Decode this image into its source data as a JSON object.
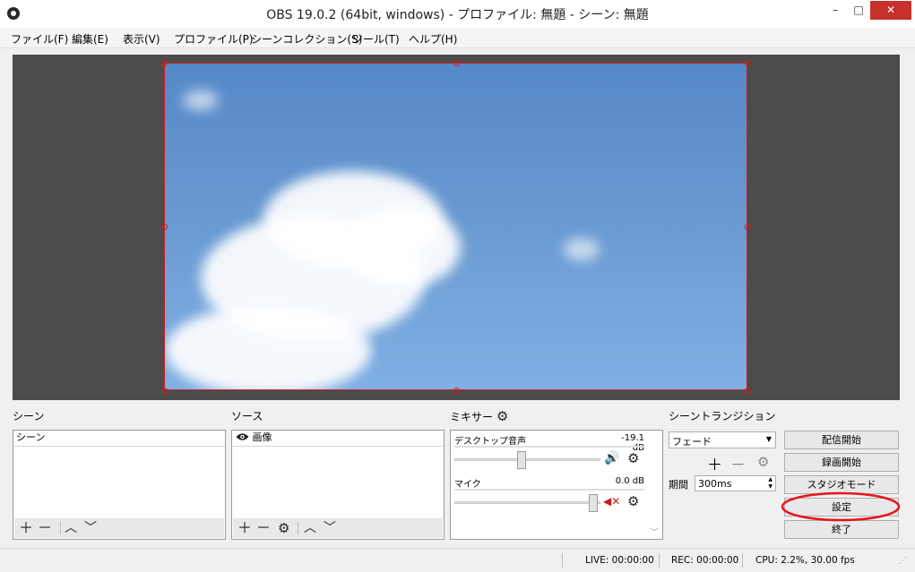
{
  "window": {
    "title": "OBS 19.0.2 (64bit, windows) - プロファイル: 無題 - シーン: 無題",
    "minimize": "–",
    "maximize": "□",
    "close": "✕"
  },
  "menu": [
    "ファイル(F)",
    "編集(E)",
    "表示(V)",
    "プロファイル(P)",
    "シーンコレクション(S)",
    "ツール(T)",
    "ヘルプ(H)"
  ],
  "scenes": {
    "title": "シーン",
    "items": [
      "シーン"
    ]
  },
  "sources": {
    "title": "ソース",
    "items": [
      {
        "name": "画像",
        "visible": true,
        "icon": "eye-icon"
      }
    ]
  },
  "mixer": {
    "title": "ミキサー",
    "channels": [
      {
        "name": "デスクトップ音声",
        "level": "-19.1 dB",
        "muted": false,
        "volume_fraction": 0.46
      },
      {
        "name": "マイク",
        "level": "0.0 dB",
        "muted": true,
        "volume_fraction": 0.98
      }
    ]
  },
  "transitions": {
    "title": "シーントランジション",
    "selected": "フェード",
    "duration_label": "期間",
    "duration_value": "300ms"
  },
  "controls": {
    "start_streaming": "配信開始",
    "start_recording": "録画開始",
    "studio_mode": "スタジオモード",
    "settings": "設定",
    "exit": "終了"
  },
  "status": {
    "live": "LIVE: 00:00:00",
    "rec": "REC: 00:00:00",
    "cpu": "CPU: 2.2%, 30.00 fps"
  },
  "colors": {
    "selection_border": "#d21c1c",
    "annotation_circle": "#e8121b",
    "muted_speaker": "#c81e1e",
    "preview_background": "#4c4c4c"
  }
}
